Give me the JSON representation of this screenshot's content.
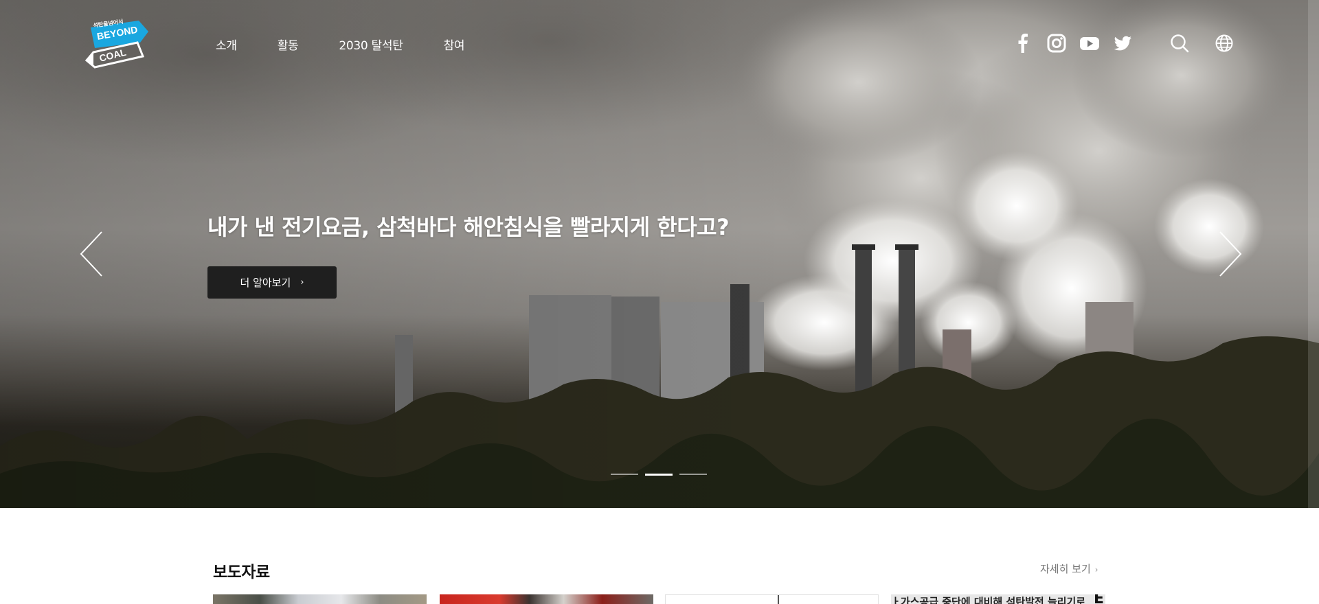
{
  "header": {
    "logo": {
      "text_top": "석탄을넘어서",
      "text_mid": "BEYOND",
      "text_bottom": "COAL",
      "brand_color": "#1aa7e0"
    },
    "nav": [
      "소개",
      "활동",
      "2030 탈석탄",
      "참여"
    ],
    "social_icons": [
      "facebook-icon",
      "instagram-icon",
      "youtube-icon",
      "twitter-icon"
    ],
    "utility_icons": [
      "search-icon",
      "globe-icon"
    ]
  },
  "hero": {
    "title": "내가 낸 전기요금, 삼척바다 해안침식을 빨라지게 한다고?",
    "button_label": "더 알아보기",
    "button_chevron": "›",
    "slide_count": 3,
    "active_slide": 2,
    "prev_icon": "chevron-left-icon",
    "next_icon": "chevron-right-icon"
  },
  "press": {
    "title": "보도자료",
    "see_more": "자세히 보기",
    "see_more_chevron": "›",
    "card_4_text": "ㅏ가스공급 중단에 대비해 석탄발전 늘리기로",
    "card_4_badge": "E"
  },
  "colors": {
    "button_bg": "#1f1f1f",
    "accent": "#1aa7e0",
    "text_dark": "#111111",
    "muted": "#777777"
  }
}
